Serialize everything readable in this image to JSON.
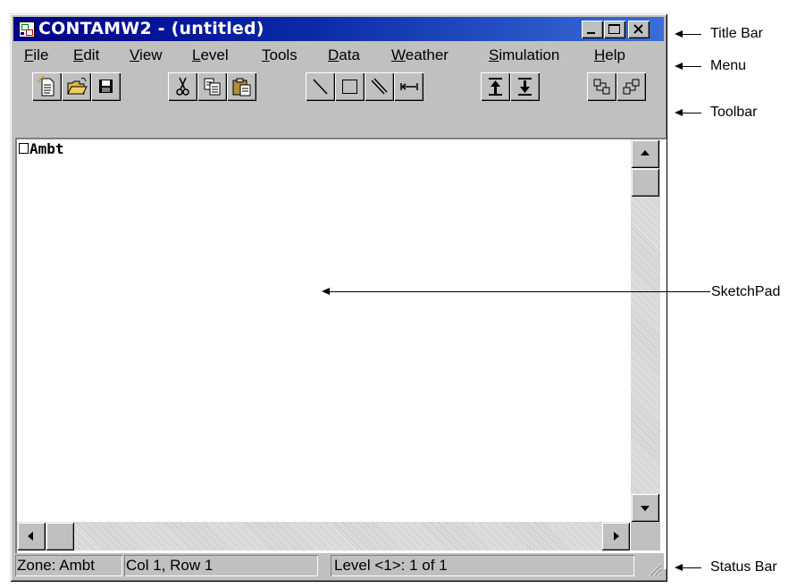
{
  "window": {
    "title": "CONTAMW2 - (untitled)",
    "caption_buttons": [
      "minimize-icon",
      "maximize-icon",
      "close-icon"
    ]
  },
  "menu": [
    {
      "label": "File",
      "accel": "F",
      "rest": "ile"
    },
    {
      "label": "Edit",
      "accel": "E",
      "rest": "dit"
    },
    {
      "label": "View",
      "accel": "V",
      "rest": "iew"
    },
    {
      "label": "Level",
      "accel": "L",
      "rest": "evel"
    },
    {
      "label": "Tools",
      "accel": "T",
      "rest": "ools"
    },
    {
      "label": "Data",
      "accel": "D",
      "rest": "ata"
    },
    {
      "label": "Weather",
      "accel": "W",
      "rest": "eather"
    },
    {
      "label": "Simulation",
      "accel": "S",
      "rest": "imulation"
    },
    {
      "label": "Help",
      "accel": "H",
      "rest": "elp"
    }
  ],
  "toolbar": [
    "new-document-icon",
    "open-folder-icon",
    "save-disk-icon",
    "cut-scissors-icon",
    "copy-icon",
    "paste-icon",
    "draw-wall-line-icon",
    "draw-rectangle-icon",
    "draw-double-line-icon",
    "draw-extend-line-icon",
    "level-up-icon",
    "level-down-icon",
    "shift-up-icon",
    "shift-down-icon"
  ],
  "sketchpad": {
    "zone_label": "Ambt"
  },
  "statusbar": {
    "zone": "Zone: Ambt",
    "position": "Col 1, Row 1",
    "level": "Level <1>: 1 of 1"
  },
  "annotations": {
    "title_bar": "Title Bar",
    "menu": "Menu",
    "toolbar": "Toolbar",
    "sketchpad": "SketchPad",
    "status_bar": "Status Bar"
  }
}
